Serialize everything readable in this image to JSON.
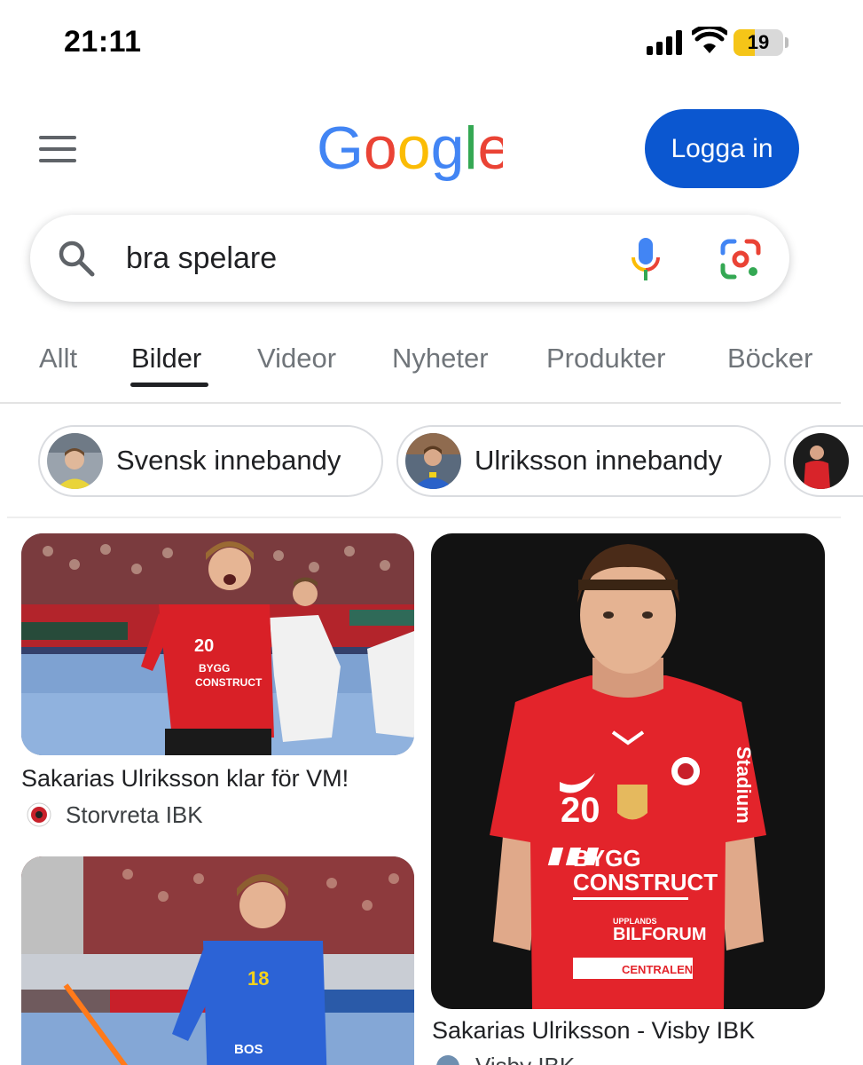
{
  "status": {
    "time": "21:11",
    "battery": "19"
  },
  "header": {
    "logo": "Google",
    "login_label": "Logga in"
  },
  "search": {
    "query": "bra spelare"
  },
  "tabs": [
    {
      "label": "Allt",
      "active": false
    },
    {
      "label": "Bilder",
      "active": true
    },
    {
      "label": "Videor",
      "active": false
    },
    {
      "label": "Nyheter",
      "active": false
    },
    {
      "label": "Produkter",
      "active": false
    },
    {
      "label": "Böcker",
      "active": false
    }
  ],
  "chips": [
    {
      "label": "Svensk innebandy"
    },
    {
      "label": "Ulriksson innebandy"
    }
  ],
  "results": [
    {
      "title": "Sakarias Ulriksson klar för VM!",
      "source": "Storvreta IBK"
    },
    {
      "title": "Sakarias Ulriksson - Visby IBK",
      "source": "Visby IBK"
    }
  ],
  "jersey": {
    "number": "20",
    "sponsor_line1": "BYGG",
    "sponsor_line2": "CONSTRUCT",
    "sponsor_line3": "BILFORUM",
    "sponsor_small": "UPPLANDS",
    "sponsor_side": "Stadium",
    "sponsor_bottom": "CENTRALEN",
    "number_blue": "18",
    "sponsor_blue": "BOS"
  },
  "colors": {
    "primary_button": "#0b57d0",
    "google_blue": "#4285f4",
    "google_red": "#ea4335",
    "google_yellow": "#fbbc05",
    "google_green": "#34a853",
    "battery_low": "#f5c518"
  }
}
